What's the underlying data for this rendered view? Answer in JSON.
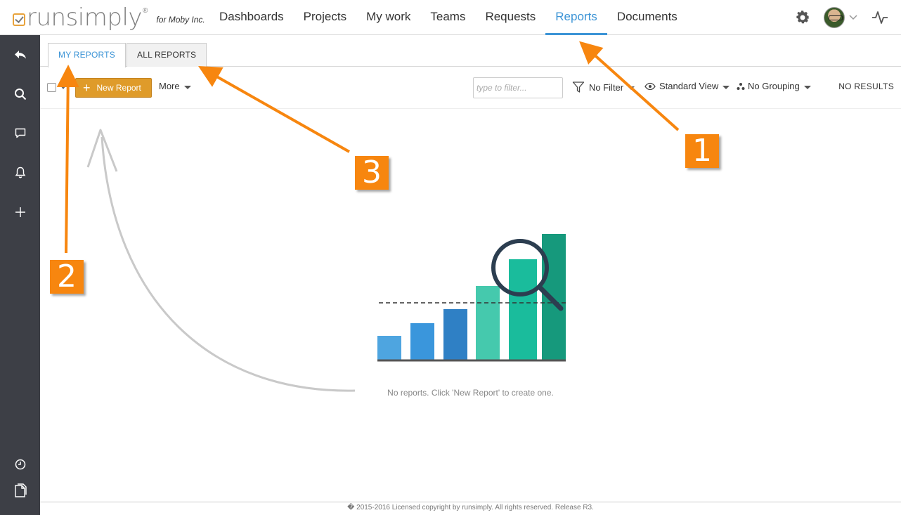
{
  "brand": {
    "name": "runsimply",
    "registered": "®",
    "org": "for Moby Inc."
  },
  "nav": {
    "items": [
      {
        "label": "Dashboards"
      },
      {
        "label": "Projects"
      },
      {
        "label": "My work"
      },
      {
        "label": "Teams"
      },
      {
        "label": "Requests"
      },
      {
        "label": "Reports"
      },
      {
        "label": "Documents"
      }
    ],
    "active": "Reports"
  },
  "top_right": {
    "icons": [
      "gear-icon",
      "avatar",
      "chevron-down-icon",
      "activity-icon"
    ]
  },
  "sidebar": {
    "icons": [
      "back-icon",
      "search-icon",
      "comment-icon",
      "bell-icon",
      "plus-icon",
      "clock-icon",
      "documents-icon"
    ]
  },
  "tabs": {
    "my_reports": "MY REPORTS",
    "all_reports": "ALL REPORTS"
  },
  "toolbar": {
    "new_report_label": "New Report",
    "more_label": "More",
    "filter_placeholder": "type to filter...",
    "no_filter_label": "No Filter",
    "view_label": "Standard View",
    "grouping_label": "No Grouping",
    "results_label": "NO RESULTS"
  },
  "empty_state": {
    "message": "No reports. Click 'New Report' to create one."
  },
  "footer": {
    "text": "� 2015-2016 Licensed copyright by runsimply. All rights reserved. Release R3."
  },
  "annotations": {
    "badge_1": "1",
    "badge_2": "2",
    "badge_3": "3"
  },
  "colors": {
    "accent": "#3c94d6",
    "button": "#df9b2a",
    "sidebar": "#3d3f46",
    "annotation": "#f7860f"
  }
}
